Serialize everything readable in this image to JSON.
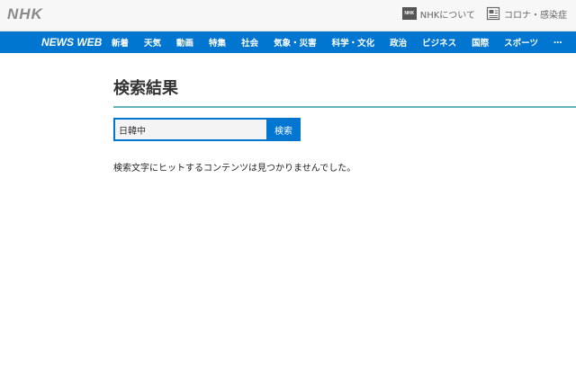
{
  "header": {
    "logo": "NHK",
    "links": [
      {
        "badge": "NHK",
        "label": "NHKについて"
      },
      {
        "label": "コロナ・感染症"
      }
    ]
  },
  "nav": {
    "brand": "NEWS WEB",
    "items": [
      "新着",
      "天気",
      "動画",
      "特集",
      "社会",
      "気象・災害",
      "科学・文化",
      "政治",
      "ビジネス",
      "国際",
      "スポーツ",
      "…"
    ]
  },
  "main": {
    "title": "検索結果",
    "search": {
      "value": "日韓中",
      "button_label": "検索"
    },
    "message": "検索文字にヒットするコンテンツは見つかりませんでした。"
  },
  "colors": {
    "brand_blue": "#0076d1",
    "rule_teal": "#63b4b8"
  }
}
